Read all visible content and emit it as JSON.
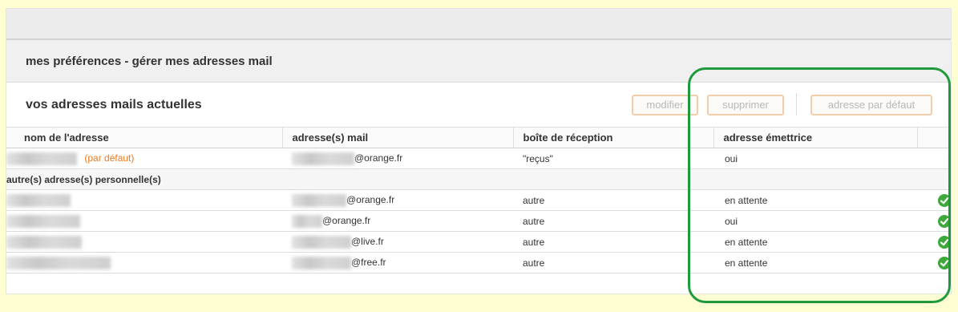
{
  "header": {
    "page_title": "mes préférences - gérer mes adresses mail"
  },
  "section": {
    "title": "vos adresses mails actuelles"
  },
  "toolbar": {
    "modify_label": "modifier",
    "delete_label": "supprimer",
    "default_label": "adresse par défaut"
  },
  "table": {
    "columns": [
      "nom de l'adresse",
      "adresse(s) mail",
      "boîte de réception",
      "adresse émettrice"
    ],
    "default_row": {
      "name_tag": "(par défaut)",
      "mail": "@orange.fr",
      "inbox": "\"reçus\"",
      "sender": "oui"
    },
    "group_label": "autre(s) adresse(s) personnelle(s)",
    "rows": [
      {
        "mail": "@orange.fr",
        "inbox": "autre",
        "sender": "en attente"
      },
      {
        "mail": "@orange.fr",
        "inbox": "autre",
        "sender": "oui"
      },
      {
        "mail": "@live.fr",
        "inbox": "autre",
        "sender": "en attente"
      },
      {
        "mail": "@free.fr",
        "inbox": "autre",
        "sender": "en attente"
      }
    ]
  },
  "colors": {
    "default_tag": "#f07a1e",
    "check": "#3fa83a",
    "highlight": "#1f9a3a",
    "button_border": "#f1ceab"
  },
  "icons": {
    "row_status": "check-icon"
  }
}
